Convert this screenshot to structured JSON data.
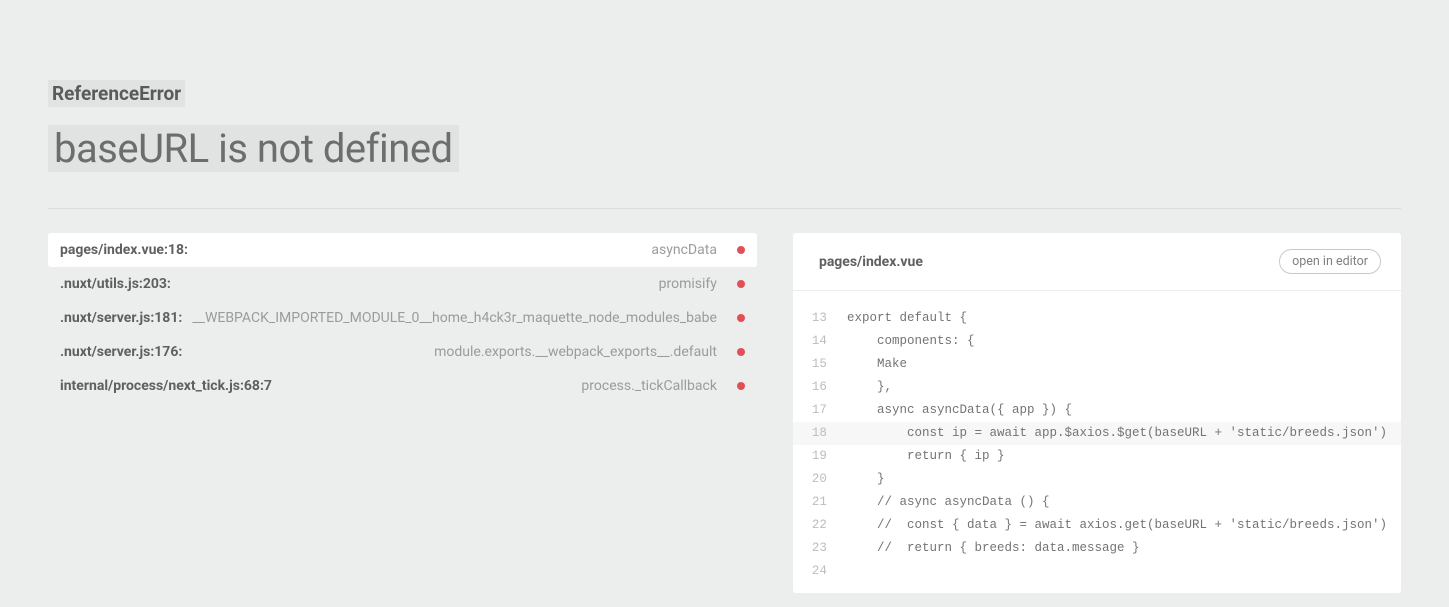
{
  "error": {
    "type": "ReferenceError",
    "message": "baseURL is not defined"
  },
  "trace": [
    {
      "file": "pages/index.vue:18:",
      "func": "asyncData",
      "active": true
    },
    {
      "file": ".nuxt/utils.js:203:",
      "func": "promisify",
      "active": false
    },
    {
      "file": ".nuxt/server.js:181:",
      "func": "__WEBPACK_IMPORTED_MODULE_0__home_h4ck3r_maquette_node_modules_babe",
      "active": false
    },
    {
      "file": ".nuxt/server.js:176:",
      "func": "module.exports.__webpack_exports__.default",
      "active": false
    },
    {
      "file": "internal/process/next_tick.js:68:7",
      "func": "process._tickCallback",
      "active": false
    }
  ],
  "source": {
    "filename": "pages/index.vue",
    "open_label": "open in editor",
    "highlight_line": 18,
    "lines": [
      {
        "n": 13,
        "t": "export default {"
      },
      {
        "n": 14,
        "t": "    components: {"
      },
      {
        "n": 15,
        "t": "    Make"
      },
      {
        "n": 16,
        "t": "    },"
      },
      {
        "n": 17,
        "t": "    async asyncData({ app }) {"
      },
      {
        "n": 18,
        "t": "        const ip = await app.$axios.$get(baseURL + 'static/breeds.json')"
      },
      {
        "n": 19,
        "t": "        return { ip }"
      },
      {
        "n": 20,
        "t": "    }"
      },
      {
        "n": 21,
        "t": "    // async asyncData () {"
      },
      {
        "n": 22,
        "t": "    //  const { data } = await axios.get(baseURL + 'static/breeds.json')"
      },
      {
        "n": 23,
        "t": "    //  return { breeds: data.message }"
      },
      {
        "n": 24,
        "t": ""
      }
    ]
  }
}
